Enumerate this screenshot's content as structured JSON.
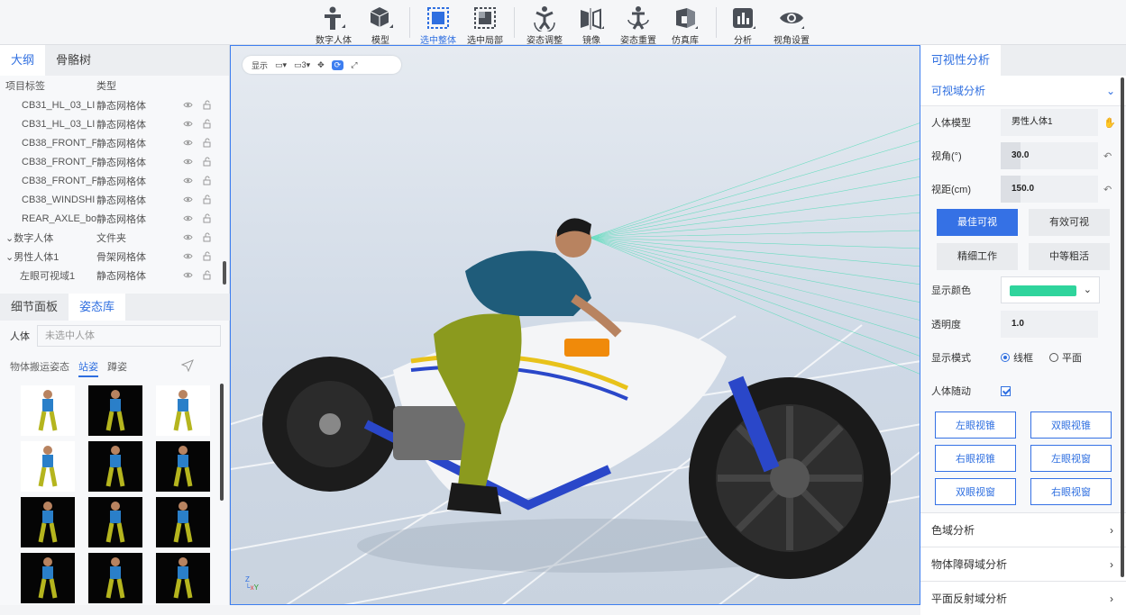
{
  "toolbar": {
    "items": [
      {
        "label": "数字人体",
        "icon": "human-figure-icon"
      },
      {
        "label": "模型",
        "icon": "cube-icon"
      },
      {
        "label": "选中整体",
        "icon": "select-all-icon",
        "active": true
      },
      {
        "label": "选中局部",
        "icon": "select-part-icon"
      },
      {
        "label": "姿态调整",
        "icon": "pose-adjust-icon"
      },
      {
        "label": "镜像",
        "icon": "mirror-icon"
      },
      {
        "label": "姿态重置",
        "icon": "pose-reset-icon"
      },
      {
        "label": "仿真库",
        "icon": "sim-library-icon"
      },
      {
        "label": "分析",
        "icon": "chart-icon"
      },
      {
        "label": "视角设置",
        "icon": "eye-icon"
      }
    ]
  },
  "outline": {
    "tabs": [
      "大纲",
      "骨骼树"
    ],
    "columns": [
      "项目标签",
      "类型"
    ],
    "rows": [
      {
        "name": "CB31_HL_03_LI",
        "type": "静态网格体",
        "indent": 1
      },
      {
        "name": "CB31_HL_03_LI",
        "type": "静态网格体",
        "indent": 1
      },
      {
        "name": "CB38_FRONT_F",
        "type": "静态网格体",
        "indent": 1
      },
      {
        "name": "CB38_FRONT_F",
        "type": "静态网格体",
        "indent": 1
      },
      {
        "name": "CB38_FRONT_F",
        "type": "静态网格体",
        "indent": 1
      },
      {
        "name": "CB38_WINDSHI",
        "type": "静态网格体",
        "indent": 1
      },
      {
        "name": "REAR_AXLE_bo",
        "type": "静态网格体",
        "indent": 1
      },
      {
        "name": "⌄数字人体",
        "type": "文件夹",
        "indent": 0
      },
      {
        "name": "⌄男性人体1",
        "type": "骨架网格体",
        "indent": 0
      },
      {
        "name": "左眼可视域1",
        "type": "静态网格体",
        "indent": 2
      }
    ]
  },
  "pose": {
    "tabs": [
      "细节面板",
      "姿态库"
    ],
    "human_label": "人体",
    "human_placeholder": "未选中人体",
    "subtabs": [
      "物体搬运姿态",
      "站姿",
      "蹲姿"
    ]
  },
  "viewport": {
    "toolbar": {
      "show_label": "显示",
      "cam_label": "3"
    }
  },
  "right": {
    "tab": "可视性分析",
    "section": "可视域分析",
    "props": {
      "model_label": "人体模型",
      "model_value": "男性人体1",
      "angle_label": "视角(°)",
      "angle_value": "30.0",
      "dist_label": "视距(cm)",
      "dist_value": "150.0",
      "color_label": "显示颜色",
      "color_value": "#2fd49c",
      "opacity_label": "透明度",
      "opacity_value": "1.0",
      "mode_label": "显示模式",
      "mode_wire": "线框",
      "mode_plane": "平面",
      "follow_label": "人体随动"
    },
    "vis_buttons": [
      "最佳可视",
      "有效可视",
      "精细工作",
      "中等粗活"
    ],
    "eye_buttons": [
      "左眼视锥",
      "双眼视锥",
      "右眼视锥",
      "左眼视窗",
      "双眼视窗",
      "右眼视窗"
    ],
    "collapsed": [
      "色域分析",
      "物体障碍域分析",
      "平面反射域分析"
    ]
  }
}
